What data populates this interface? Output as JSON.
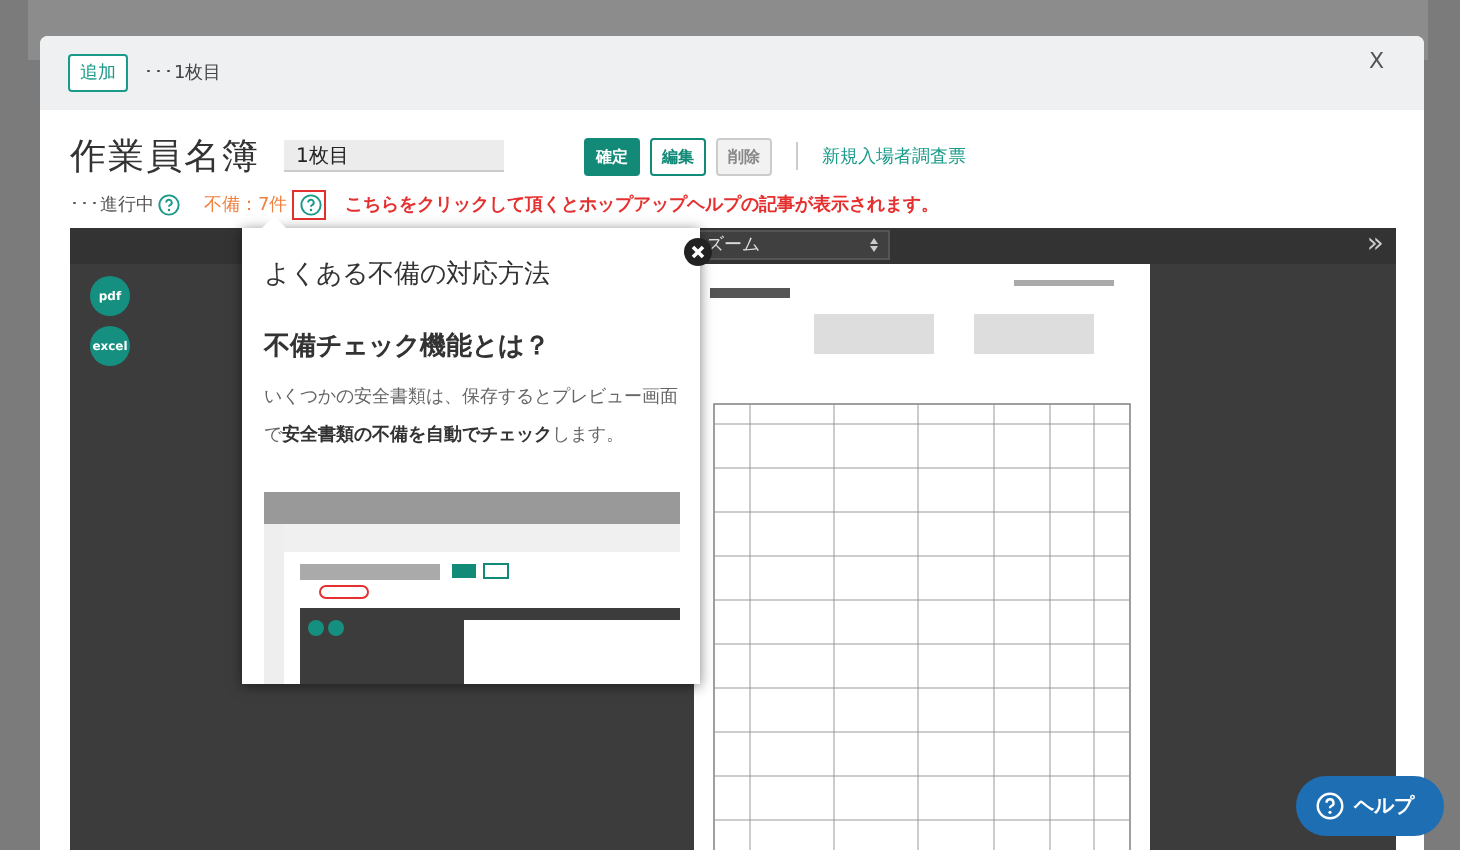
{
  "modal": {
    "header": {
      "add_button": "追加",
      "page_label": "･･･1枚目",
      "close": "X"
    },
    "title": "作業員名簿",
    "name_field": {
      "value": "1枚目"
    },
    "actions": [
      {
        "kind": "primary",
        "label": "確定"
      },
      {
        "kind": "outline",
        "label": "編集"
      },
      {
        "kind": "muted",
        "label": "削除"
      }
    ],
    "link": "新規入場者調査票",
    "status": {
      "progress": "･･･進行中",
      "defects": "不備：7件",
      "callout": "こちらをクリックして頂くとホップアップヘルプの記事が表示されます。"
    },
    "viewer": {
      "zoom_select": "ズーム",
      "expand": "»",
      "downloads": [
        "pdf",
        "excel"
      ]
    },
    "popover": {
      "title": "よくある不備の対応方法",
      "heading": "不備チェック機能とは？",
      "body": "いくつかの安全書類は、保存するとプレビュー画面で**安全書類の不備を自動でチェック**します。"
    }
  },
  "help_button": "ヘルプ"
}
